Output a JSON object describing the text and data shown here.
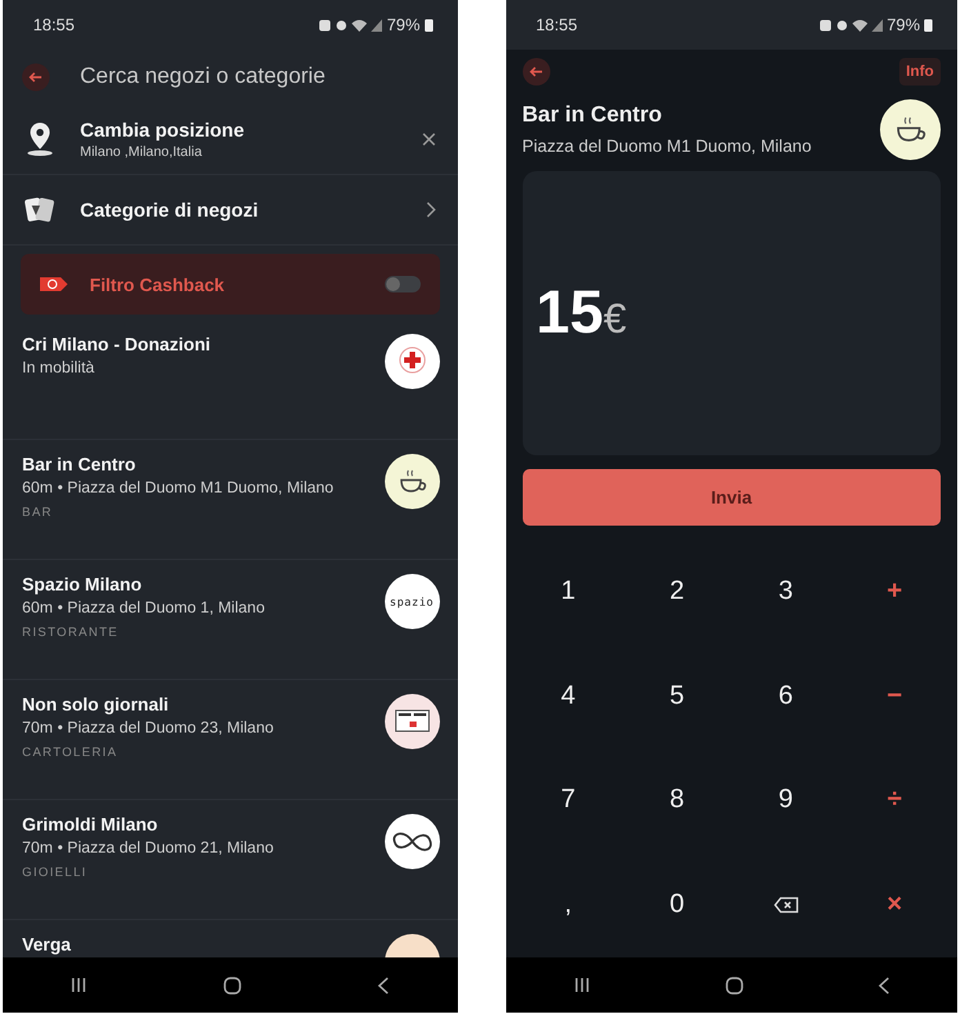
{
  "search_screen": {
    "status_bar": {
      "time": "18:55",
      "battery": "79%"
    },
    "search": {
      "placeholder": "Cerca negozi o categorie"
    },
    "location": {
      "title": "Cambia posizione",
      "subtitle": "Milano ,Milano,Italia"
    },
    "categories": {
      "label": "Categorie di negozi"
    },
    "cashback_filter": {
      "label": "Filtro Cashback",
      "on": false
    },
    "stores": [
      {
        "name": "Cri Milano - Donazioni",
        "address": "In mobilità",
        "logo": {
          "kind": "cross"
        }
      },
      {
        "name": "Bar in Centro",
        "address": "60m • Piazza del Duomo M1 Duomo, Milano",
        "category": "BAR",
        "logo": {
          "kind": "cup"
        }
      },
      {
        "name": "Spazio Milano",
        "address": "60m • Piazza del Duomo 1, Milano",
        "category": "RISTORANTE",
        "logo": {
          "kind": "wordmark",
          "text": "spazio"
        }
      },
      {
        "name": "Non solo giornali",
        "address": "70m • Piazza del Duomo 23, Milano",
        "category": "CARTOLERIA",
        "logo": {
          "kind": "newspaper"
        }
      },
      {
        "name": "Grimoldi Milano",
        "address": "70m • Piazza del Duomo 21, Milano",
        "category": "GIOIELLI",
        "logo": {
          "kind": "loop"
        }
      },
      {
        "name": "Verga",
        "logo": {
          "kind": "plain"
        }
      }
    ]
  },
  "payment_screen": {
    "status_bar": {
      "time": "18:55",
      "battery": "79%"
    },
    "info_button": "Info",
    "store": {
      "name": "Bar in Centro",
      "address": "Piazza del Duomo M1 Duomo, Milano",
      "logo": {
        "kind": "cup"
      }
    },
    "amount": {
      "value": "15",
      "currency": "€"
    },
    "send_button": "Invia",
    "keypad": [
      {
        "kind": "digit",
        "label": "1"
      },
      {
        "kind": "digit",
        "label": "2"
      },
      {
        "kind": "digit",
        "label": "3"
      },
      {
        "kind": "operator",
        "label": "+"
      },
      {
        "kind": "digit",
        "label": "4"
      },
      {
        "kind": "digit",
        "label": "5"
      },
      {
        "kind": "digit",
        "label": "6"
      },
      {
        "kind": "operator",
        "label": "−"
      },
      {
        "kind": "digit",
        "label": "7"
      },
      {
        "kind": "digit",
        "label": "8"
      },
      {
        "kind": "digit",
        "label": "9"
      },
      {
        "kind": "operator",
        "label": "÷"
      },
      {
        "kind": "digit",
        "label": ","
      },
      {
        "kind": "digit",
        "label": "0"
      },
      {
        "kind": "backspace"
      },
      {
        "kind": "operator",
        "label": "×"
      }
    ]
  }
}
